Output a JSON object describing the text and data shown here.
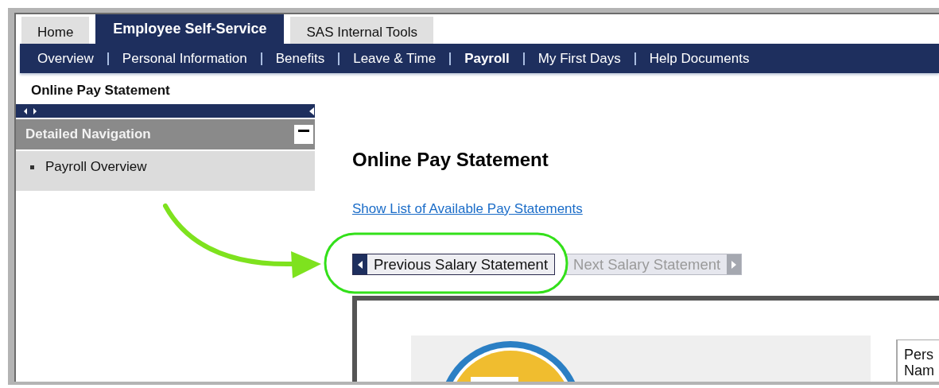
{
  "tabs": [
    {
      "label": "Home",
      "selected": false
    },
    {
      "label": "Employee Self-Service",
      "selected": true
    },
    {
      "label": "SAS Internal Tools",
      "selected": false
    }
  ],
  "nav": [
    {
      "label": "Overview",
      "selected": false
    },
    {
      "label": "Personal Information",
      "selected": false
    },
    {
      "label": "Benefits",
      "selected": false
    },
    {
      "label": "Leave & Time",
      "selected": false
    },
    {
      "label": "Payroll",
      "selected": true
    },
    {
      "label": "My First Days",
      "selected": false
    },
    {
      "label": "Help Documents",
      "selected": false
    }
  ],
  "breadcrumb": "Online Pay Statement",
  "sidebar": {
    "title": "Detailed Navigation",
    "expanded": true,
    "items": [
      "Payroll Overview"
    ]
  },
  "content": {
    "heading": "Online Pay Statement",
    "link": "Show List of Available Pay Statements",
    "buttons": [
      {
        "label": "Previous Salary Statement",
        "kind": "previous",
        "disabled": false
      },
      {
        "label": "Next Salary Statement",
        "kind": "next",
        "disabled": true
      }
    ],
    "document": {
      "box_lines": [
        "Pers",
        "Nam"
      ]
    }
  }
}
